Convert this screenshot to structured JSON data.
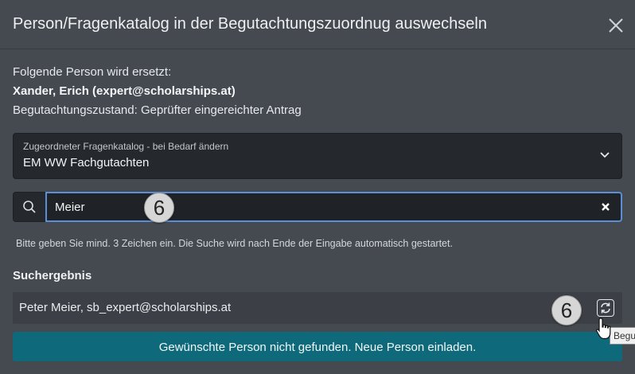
{
  "dialog": {
    "title": "Person/Fragenkatalog in der Begutachtungszuordnug auswechseln"
  },
  "info": {
    "line1": "Folgende Person wird ersetzt:",
    "person": "Xander, Erich (expert@scholarships.at)",
    "state": "Begutachtungszustand: Geprüfter eingereichter Antrag"
  },
  "catalog_select": {
    "label": "Zugeordneter Fragenkatalog - bei Bedarf ändern",
    "value": "EM WW Fachgutachten"
  },
  "search": {
    "value": "Meier",
    "hint": "Bitte geben Sie mind. 3 Zeichen ein. Die Suche wird nach Ende der Eingabe automatisch gestartet."
  },
  "results": {
    "title": "Suchergebnis",
    "items": [
      {
        "text": "Peter Meier, sb_expert@scholarships.at"
      }
    ]
  },
  "invite_button": "Gewünschte Person nicht gefunden. Neue Person einladen.",
  "annotations": {
    "badge1": "6",
    "badge2": "6"
  },
  "tooltip": "Begu",
  "icons": {
    "close": "close-icon",
    "chevron": "chevron-down-icon",
    "search": "search-icon",
    "clear": "clear-icon",
    "swap": "refresh-swap-icon",
    "cursor": "hand-pointer-icon"
  }
}
